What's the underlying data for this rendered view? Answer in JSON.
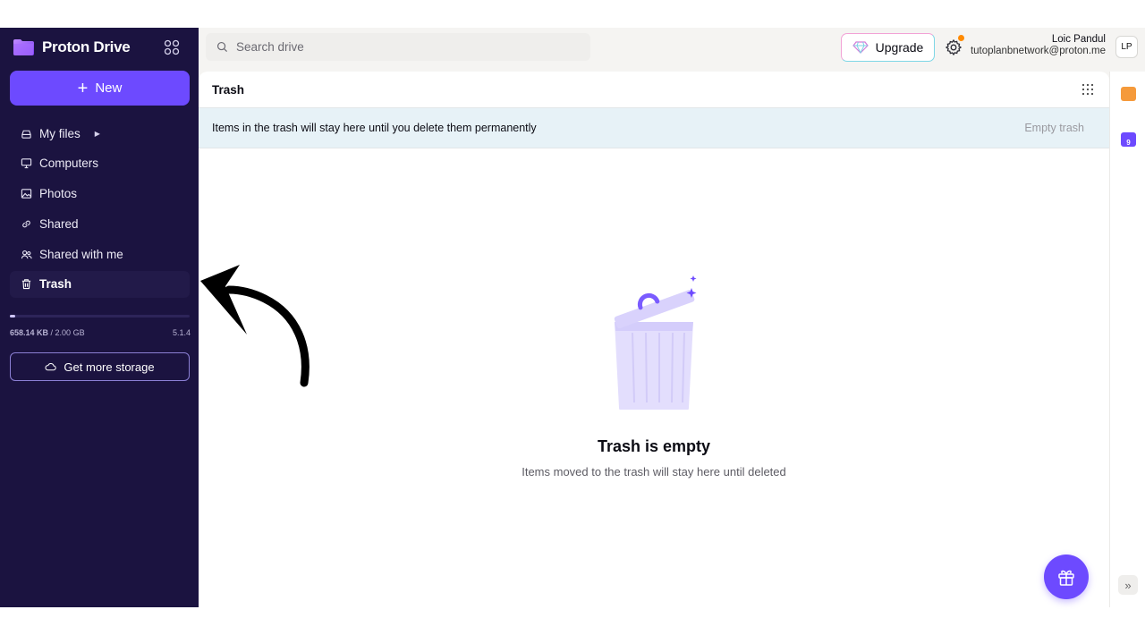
{
  "app": {
    "brand": "Proton Drive"
  },
  "sidebar": {
    "new_label": "New",
    "items": [
      {
        "label": "My files",
        "icon": "cloud-icon",
        "has_caret": true
      },
      {
        "label": "Computers",
        "icon": "monitor-icon"
      },
      {
        "label": "Photos",
        "icon": "image-icon"
      },
      {
        "label": "Shared",
        "icon": "link-icon"
      },
      {
        "label": "Shared with me",
        "icon": "users-icon"
      },
      {
        "label": "Trash",
        "icon": "trash-icon",
        "active": true
      }
    ],
    "storage": {
      "used": "658.14 KB",
      "sep": " / ",
      "total": "2.00 GB",
      "fill_fraction": 0.03,
      "version": "5.1.4",
      "get_more_label": "Get more storage"
    }
  },
  "topbar": {
    "search_placeholder": "Search drive",
    "upgrade_label": "Upgrade",
    "user_name": "Loic Pandul",
    "user_email": "tutoplanbnetwork@proton.me",
    "avatar_initials": "LP"
  },
  "main": {
    "title": "Trash",
    "banner_text": "Items in the trash will stay here until you delete them permanently",
    "empty_trash_label": "Empty trash",
    "empty_title": "Trash is empty",
    "empty_subtitle": "Items moved to the trash will stay here until deleted"
  },
  "rail": {
    "calendar_badge": "9"
  },
  "colors": {
    "sidebar_bg": "#1b1340",
    "accent": "#6d4aff",
    "banner_bg": "#e7f2f7"
  }
}
